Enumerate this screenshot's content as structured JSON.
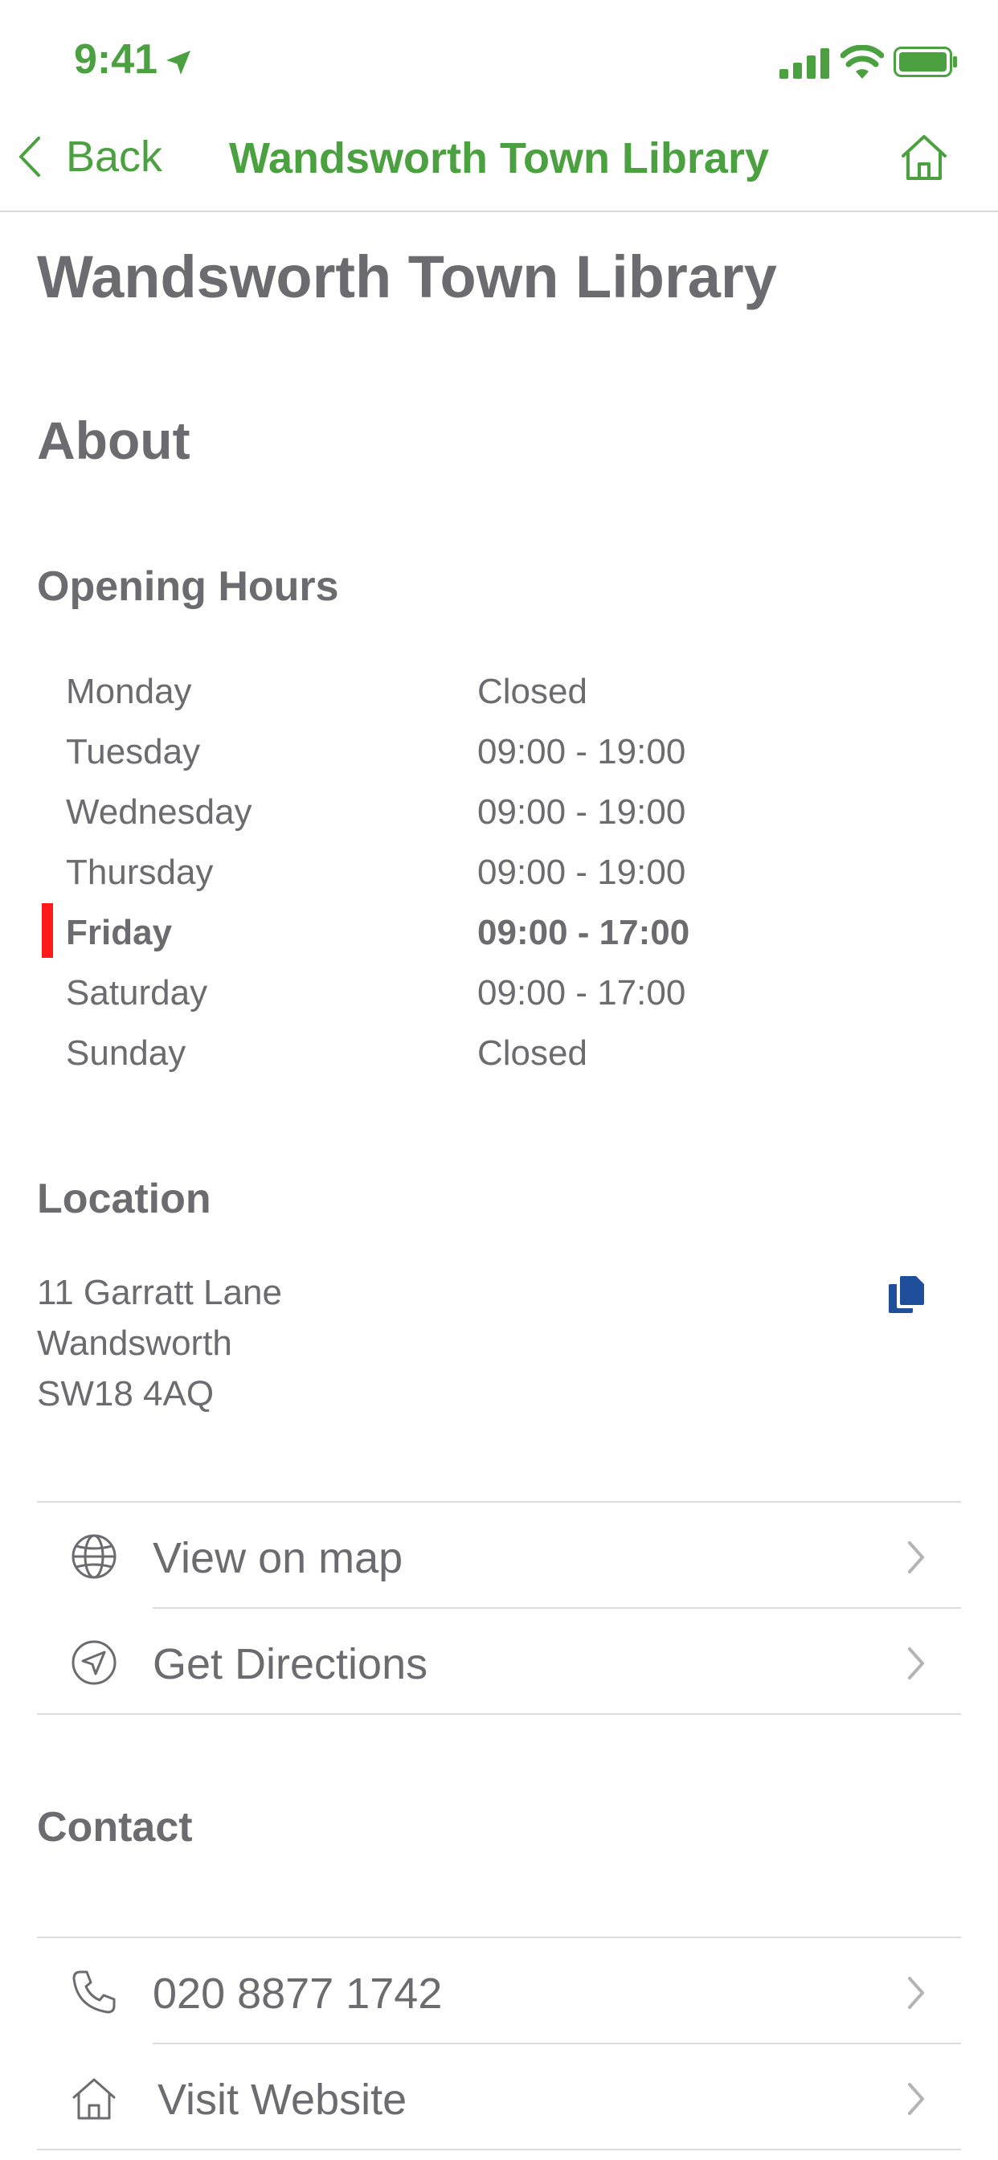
{
  "status_bar": {
    "time": "9:41"
  },
  "nav": {
    "back_label": "Back",
    "title": "Wandsworth Town Library"
  },
  "page": {
    "title": "Wandsworth Town Library",
    "about_heading": "About"
  },
  "opening_hours": {
    "heading": "Opening Hours",
    "days": [
      {
        "day": "Monday",
        "hours": "Closed"
      },
      {
        "day": "Tuesday",
        "hours": "09:00 - 19:00"
      },
      {
        "day": "Wednesday",
        "hours": "09:00 - 19:00"
      },
      {
        "day": "Thursday",
        "hours": "09:00 - 19:00"
      },
      {
        "day": "Friday",
        "hours": "09:00 - 17:00",
        "today": true
      },
      {
        "day": "Saturday",
        "hours": "09:00 - 17:00"
      },
      {
        "day": "Sunday",
        "hours": "Closed"
      }
    ]
  },
  "location": {
    "heading": "Location",
    "address_lines": [
      "11 Garratt Lane",
      "Wandsworth",
      "SW18 4AQ"
    ],
    "actions": [
      {
        "label": "View on map",
        "icon": "globe-icon"
      },
      {
        "label": "Get Directions",
        "icon": "directions-icon"
      }
    ]
  },
  "contact": {
    "heading": "Contact",
    "actions": [
      {
        "label": "020 8877 1742",
        "icon": "phone-icon"
      },
      {
        "label": "Visit Website",
        "icon": "home-icon"
      }
    ]
  },
  "colors": {
    "accent_green": "#4ba140",
    "text_gray": "#6b6b70",
    "today_marker": "#ff1a1a",
    "copy_icon_blue": "#1f4e9a"
  }
}
